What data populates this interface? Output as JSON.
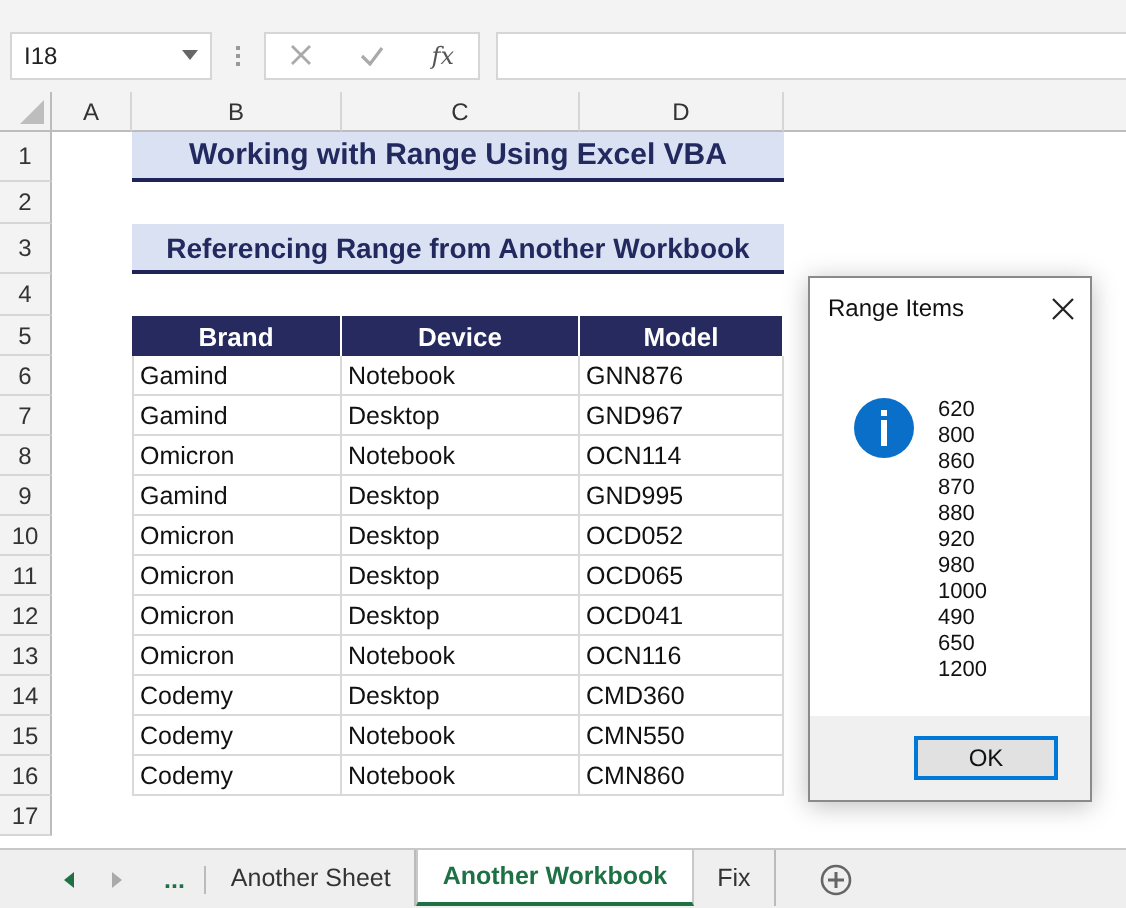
{
  "formula_bar": {
    "name_box": "I18",
    "fx": "fx"
  },
  "column_headers": [
    "A",
    "B",
    "C",
    "D"
  ],
  "row_numbers": [
    "1",
    "2",
    "3",
    "4",
    "5",
    "6",
    "7",
    "8",
    "9",
    "10",
    "11",
    "12",
    "13",
    "14",
    "15",
    "16",
    "17"
  ],
  "title": "Working with Range Using Excel VBA",
  "subtitle": "Referencing Range from Another Workbook",
  "table": {
    "columns": [
      "Brand",
      "Device",
      "Model"
    ],
    "rows": [
      [
        "Gamind",
        "Notebook",
        "GNN876"
      ],
      [
        "Gamind",
        "Desktop",
        "GND967"
      ],
      [
        "Omicron",
        "Notebook",
        "OCN114"
      ],
      [
        "Gamind",
        "Desktop",
        "GND995"
      ],
      [
        "Omicron",
        "Desktop",
        "OCD052"
      ],
      [
        "Omicron",
        "Desktop",
        "OCD065"
      ],
      [
        "Omicron",
        "Desktop",
        "OCD041"
      ],
      [
        "Omicron",
        "Notebook",
        "OCN116"
      ],
      [
        "Codemy",
        "Desktop",
        "CMD360"
      ],
      [
        "Codemy",
        "Notebook",
        "CMN550"
      ],
      [
        "Codemy",
        "Notebook",
        "CMN860"
      ]
    ]
  },
  "dialog": {
    "title": "Range Items",
    "items": [
      "620",
      "800",
      "860",
      "870",
      "880",
      "920",
      "980",
      "1000",
      "490",
      "650",
      "1200"
    ],
    "button": "OK"
  },
  "sheet_tabs": {
    "more": "...",
    "tabs": [
      {
        "label": "Another Sheet",
        "selected": false
      },
      {
        "label": "Another Workbook",
        "selected": true
      },
      {
        "label": "Fix",
        "selected": false
      }
    ]
  }
}
